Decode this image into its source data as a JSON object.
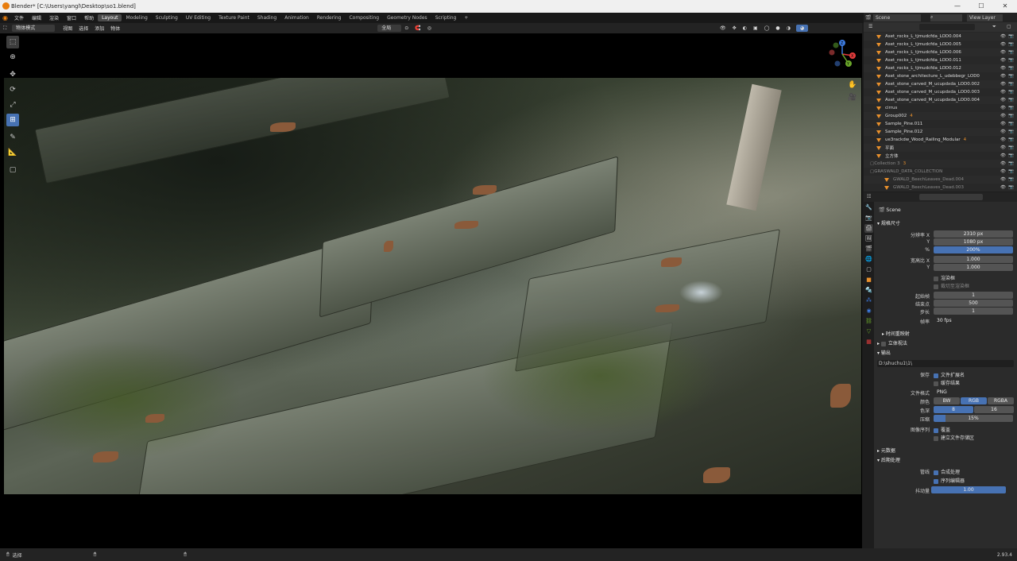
{
  "window": {
    "title": "Blender* [C:\\Users\\yangl\\Desktop\\so1.blend]",
    "min": "—",
    "max": "☐",
    "close": "✕"
  },
  "menu": [
    "文件",
    "编辑",
    "渲染",
    "窗口",
    "帮助"
  ],
  "workspaces": [
    "Layout",
    "Modeling",
    "Sculpting",
    "UV Editing",
    "Texture Paint",
    "Shading",
    "Animation",
    "Rendering",
    "Compositing",
    "Geometry Nodes",
    "Scripting"
  ],
  "workspace_add": "+",
  "scene": {
    "name": "Scene",
    "view_layer": "View Layer"
  },
  "viewport_header": {
    "mode": "物体模式",
    "menus": [
      "视图",
      "选择",
      "添加",
      "物体"
    ],
    "transform": "全局"
  },
  "gizmo": {
    "x": "X",
    "y": "Y",
    "z": "Z"
  },
  "outliner": {
    "rows": [
      "Aset_rocks_L_tjmudcfda_LOD0.004",
      "Aset_rocks_L_tjmudcfda_LOD0.005",
      "Aset_rocks_L_tjmudcfda_LOD0.006",
      "Aset_rocks_L_tjmudcfda_LOD0.011",
      "Aset_rocks_L_tjmudcfda_LOD0.012",
      "Aset_stone_architecture_L_udebbegr_LOD0",
      "Aset_stone_carved_M_ucupdxda_LOD0.002",
      "Aset_stone_carved_M_ucupdxda_LOD0.003",
      "Aset_stone_carved_M_ucupdxda_LOD0.004",
      "cirrus",
      "Group002",
      "Sample_Pine.011",
      "Sample_Pine.012",
      "ue3rackdw_Wood_Railing_Modular",
      "平面",
      "立方体",
      "Collection 3",
      "GRASWALD_DATA_COLLECTION",
      "GWALD_BeechLeaves_Dead.004",
      "GWALD_BeechLeaves_Dead.003"
    ],
    "badges": {
      "group": "4",
      "railing": "4",
      "coll3": "3"
    }
  },
  "properties": {
    "scene_label": "Scene",
    "sections": {
      "format": "规格尺寸",
      "frame": "",
      "stereo": "立体视法",
      "output": "输出",
      "time_remap": "时间重映射",
      "metadata": "元数据",
      "post": "后期处理"
    },
    "resolution_x_label": "分辨率 X",
    "resolution_x": "2310 px",
    "resolution_y_label": "Y",
    "resolution_y": "1080 px",
    "percent_label": "%",
    "percent": "200%",
    "aspect_x_label": "宽高比 X",
    "aspect_x": "1.000",
    "aspect_y_label": "Y",
    "aspect_y": "1.000",
    "render_region": "渲染框",
    "crop_region": "裁切至渲染框",
    "frame_start_label": "起始帧",
    "frame_start": "1",
    "frame_end_label": "结束点",
    "frame_end": "500",
    "frame_step_label": "步长",
    "frame_step": "1",
    "fps_label": "帧率",
    "fps": "30 fps",
    "output_path": "D:\\shuchu1\\1\\",
    "save_label": "保存",
    "file_ext": "文件扩展名",
    "cache_result": "缓存结果",
    "file_format_label": "文件格式",
    "file_format": "PNG",
    "color_label": "颜色",
    "color_opts": [
      "BW",
      "RGB",
      "RGBA"
    ],
    "depth_label": "色深",
    "depth_opts": [
      "8",
      "16"
    ],
    "compression_label": "压缩",
    "compression": "15%",
    "image_seq_label": "图像序列",
    "overwrite": "覆盖",
    "placeholders": "建立文件存储区",
    "pipeline_label": "管线",
    "compositing": "合成处理",
    "sequencer": "序列编辑器",
    "dither_label": "抖动量",
    "dither": "1.00"
  },
  "status": {
    "select": "选择",
    "version": "2.93.4"
  }
}
